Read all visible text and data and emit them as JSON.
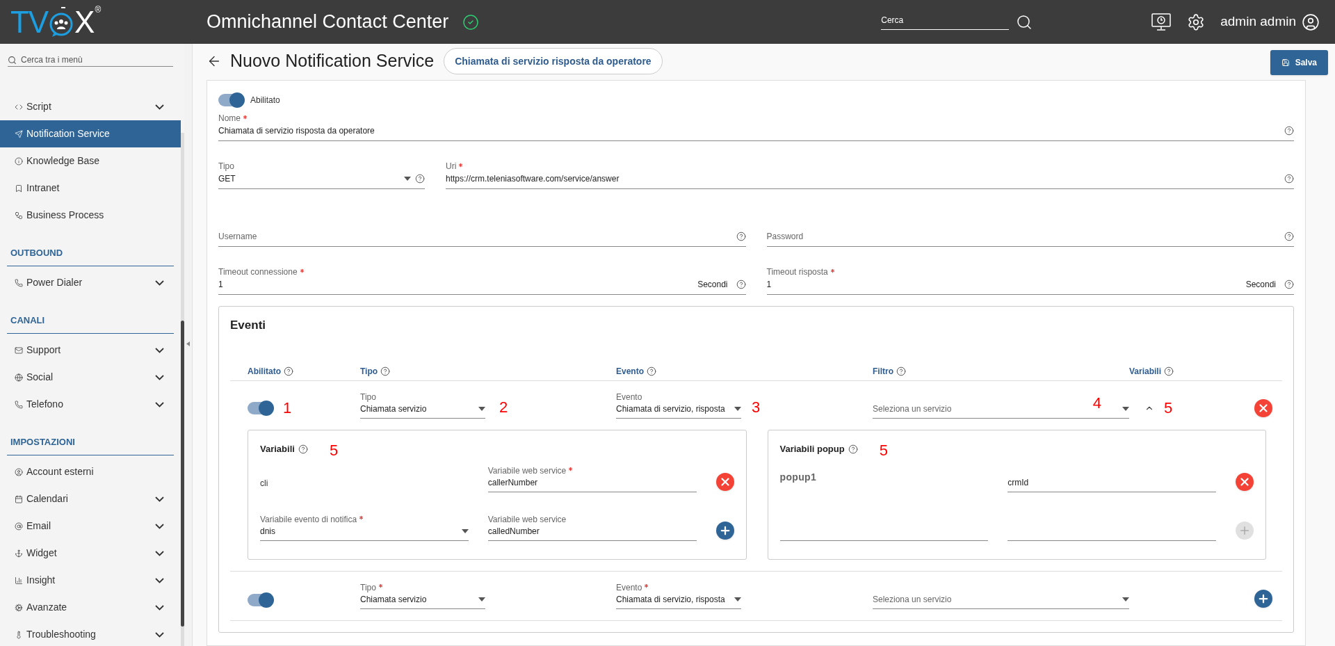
{
  "header": {
    "logo_left": "TV",
    "logo_right": "X",
    "logo_mark": "®",
    "title": "Omnichannel Contact Center",
    "search_placeholder": "Cerca",
    "user": "admin admin"
  },
  "sidebar": {
    "search_placeholder": "Cerca tra i menù",
    "groups": [
      {
        "items": [
          {
            "label": "Script",
            "submenu": true,
            "selected": false
          },
          {
            "label": "Notification Service",
            "submenu": false,
            "selected": true
          },
          {
            "label": "Knowledge Base",
            "submenu": false,
            "selected": false
          },
          {
            "label": "Intranet",
            "submenu": false,
            "selected": false
          },
          {
            "label": "Business Process",
            "submenu": false,
            "selected": false
          }
        ]
      },
      {
        "title": "OUTBOUND",
        "items": [
          {
            "label": "Power Dialer",
            "submenu": true,
            "selected": false
          }
        ]
      },
      {
        "title": "CANALI",
        "items": [
          {
            "label": "Support",
            "submenu": true,
            "selected": false
          },
          {
            "label": "Social",
            "submenu": true,
            "selected": false
          },
          {
            "label": "Telefono",
            "submenu": true,
            "selected": false
          }
        ]
      },
      {
        "title": "IMPOSTAZIONI",
        "items": [
          {
            "label": "Account esterni",
            "submenu": false,
            "selected": false
          },
          {
            "label": "Calendari",
            "submenu": true,
            "selected": false
          },
          {
            "label": "Email",
            "submenu": true,
            "selected": false
          },
          {
            "label": "Widget",
            "submenu": true,
            "selected": false
          },
          {
            "label": "Insight",
            "submenu": true,
            "selected": false
          },
          {
            "label": "Avanzate",
            "submenu": true,
            "selected": false
          },
          {
            "label": "Troubleshooting",
            "submenu": true,
            "selected": false
          }
        ]
      }
    ]
  },
  "page": {
    "title": "Nuovo Notification Service",
    "chip": "Chiamata di servizio risposta da operatore",
    "save": "Salva"
  },
  "form": {
    "enabled": {
      "label": "Abilitato",
      "on": true
    },
    "rows": [
      [
        {
          "kind": "text",
          "label": "Nome",
          "required": true,
          "value": "Chiamata di servizio risposta da operatore",
          "help": true
        }
      ],
      [
        {
          "kind": "select",
          "label": "Tipo",
          "required": false,
          "value": "GET",
          "help": true
        },
        {
          "kind": "text",
          "label": "Uri",
          "required": true,
          "value": "https://crm.teleniasoftware.com/service/answer",
          "help": true
        }
      ],
      [
        {
          "kind": "text",
          "label": "Username",
          "required": false,
          "help": true
        },
        {
          "kind": "text",
          "label": "Password",
          "required": false,
          "help": true
        }
      ],
      [
        {
          "kind": "text",
          "label": "Timeout connessione",
          "required": true,
          "value": "1",
          "suffix": "Secondi",
          "help": true
        },
        {
          "kind": "text",
          "label": "Timeout risposta",
          "required": true,
          "value": "1",
          "suffix": "Secondi",
          "help": true
        }
      ]
    ]
  },
  "events": {
    "title": "Eventi",
    "columns": [
      {
        "label": "Abilitato"
      },
      {
        "label": "Tipo"
      },
      {
        "label": "Evento"
      },
      {
        "label": "Filtro"
      },
      {
        "label": "Variabili"
      }
    ],
    "rows": [
      {
        "on": true,
        "annotation": "1",
        "tipo": {
          "label": "Tipo",
          "required": false,
          "value": "Chiamata servizio",
          "annotation": "2"
        },
        "evento": {
          "label": "Evento",
          "required": false,
          "value": "Chiamata di servizio, risposta",
          "annotation": "3"
        },
        "filtro": {
          "placeholder": "Seleziona un servizio",
          "annotation": "4"
        },
        "variabili": {
          "expanded": true,
          "annotation": "5"
        },
        "kind": "remove",
        "panels": [
          {
            "title": "Variabili",
            "annotation": "5",
            "rows": [
              {
                "left": {
                  "kind": "text",
                  "value": "cli"
                },
                "right": {
                  "kind": "input",
                  "label": "Variabile web service",
                  "required": true,
                  "value": "callerNumber"
                },
                "kind": "remove",
                "disabled": false
              },
              {
                "left": {
                  "kind": "select",
                  "label": "Variabile evento di notifica",
                  "required": true,
                  "value": "dnis"
                },
                "right": {
                  "kind": "input",
                  "label": "Variabile web service",
                  "required": false,
                  "value": "calledNumber"
                },
                "kind": "add",
                "disabled": false
              }
            ]
          },
          {
            "title": "Variabili popup",
            "annotation": "5",
            "rows": [
              {
                "left": {
                  "kind": "name",
                  "value": "popup1"
                },
                "right": {
                  "kind": "input",
                  "value": "crmId"
                },
                "kind": "remove",
                "disabled": false
              },
              {
                "left": {
                  "kind": "input"
                },
                "right": {
                  "kind": "input"
                },
                "kind": "add",
                "disabled": true
              }
            ]
          }
        ]
      },
      {
        "on": true,
        "tipo": {
          "label": "Tipo",
          "required": true,
          "value": "Chiamata servizio"
        },
        "evento": {
          "label": "Evento",
          "required": true,
          "value": "Chiamata di servizio, risposta"
        },
        "filtro": {
          "placeholder": "Seleziona un servizio"
        },
        "kind": "add"
      }
    ]
  }
}
